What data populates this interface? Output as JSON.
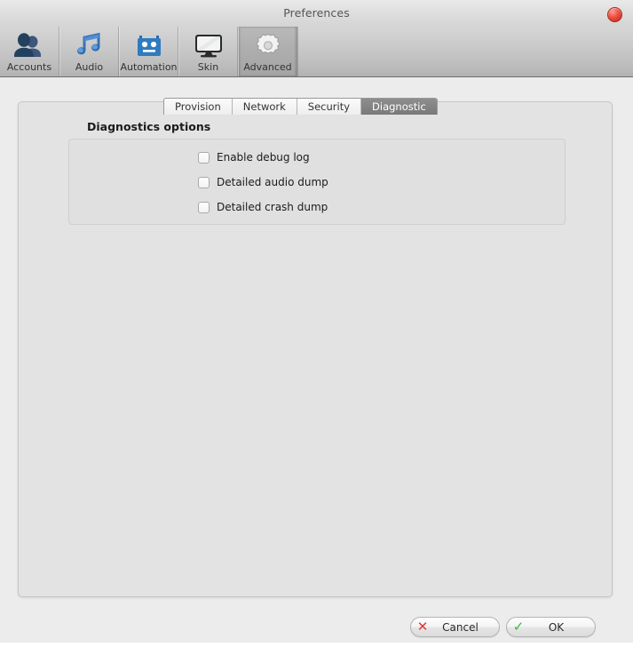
{
  "window": {
    "title": "Preferences",
    "close_icon": "close-circle-icon"
  },
  "toolbar": {
    "items": [
      {
        "label": "Accounts",
        "icon": "accounts-people-icon",
        "selected": false
      },
      {
        "label": "Audio",
        "icon": "audio-music-note-icon",
        "selected": false
      },
      {
        "label": "Automation",
        "icon": "automation-robot-icon",
        "selected": false
      },
      {
        "label": "Skin",
        "icon": "skin-monitor-icon",
        "selected": false
      },
      {
        "label": "Advanced",
        "icon": "advanced-gear-icon",
        "selected": true
      }
    ]
  },
  "tabs": [
    {
      "label": "Provision",
      "active": false
    },
    {
      "label": "Network",
      "active": false
    },
    {
      "label": "Security",
      "active": false
    },
    {
      "label": "Diagnostic",
      "active": true
    }
  ],
  "content": {
    "section_title": "Diagnostics options",
    "options": [
      {
        "label": "Enable debug log",
        "checked": false
      },
      {
        "label": "Detailed audio dump",
        "checked": false
      },
      {
        "label": "Detailed crash dump",
        "checked": false
      }
    ]
  },
  "footer": {
    "cancel": {
      "label": "Cancel",
      "icon": "cross-icon",
      "icon_glyph": "✕",
      "color": "#e03a30"
    },
    "ok": {
      "label": "OK",
      "icon": "check-icon",
      "icon_glyph": "✓",
      "color": "#2fbd2f"
    }
  },
  "colors": {
    "window_bg": "#ececec",
    "panel_bg": "#e3e3e3",
    "groupbox_bg": "#e0e0e0",
    "toolbar_top": "#d6d6d6",
    "active_tab_bg": "#797979",
    "close_red": "#ef5146"
  }
}
